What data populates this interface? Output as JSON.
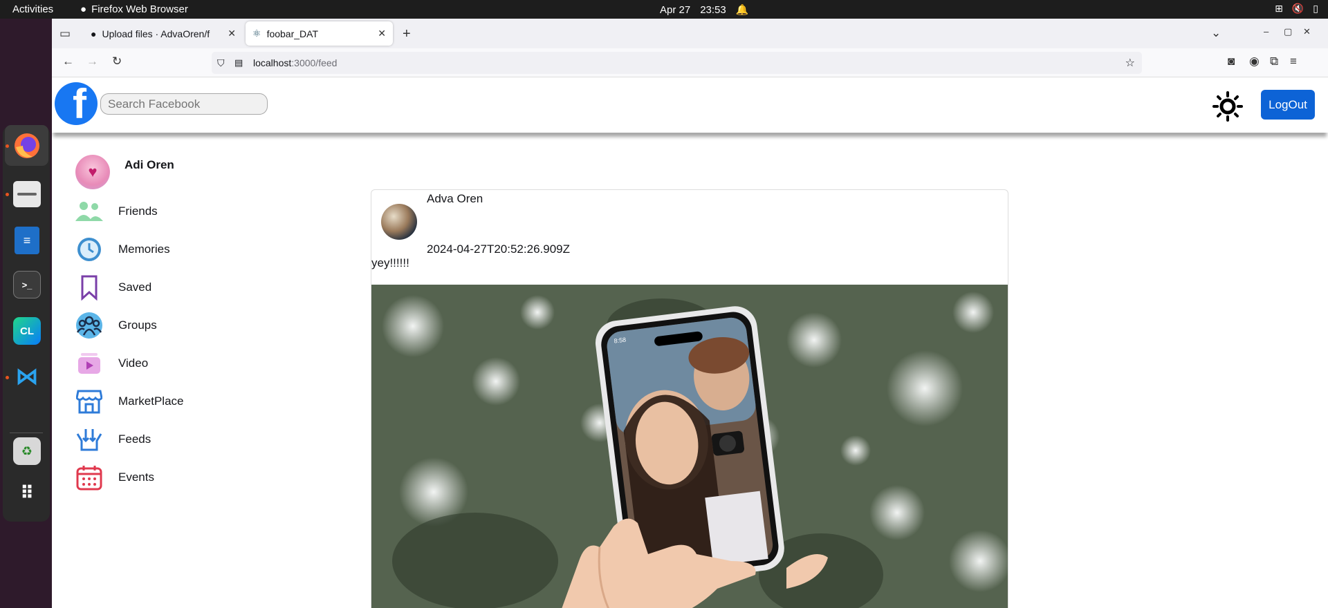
{
  "system": {
    "activities": "Activities",
    "app_name": "Firefox Web Browser",
    "date": "Apr 27",
    "time": "23:53"
  },
  "browser": {
    "tabs": [
      {
        "label": "Upload files · AdvaOren/f",
        "icon": "github-icon"
      },
      {
        "label": "foobar_DAT",
        "icon": "react-icon"
      }
    ],
    "url": {
      "host": "localhost",
      "path": ":3000/feed"
    }
  },
  "header": {
    "logo": "f",
    "search_placeholder": "Search Facebook",
    "logout_label": "LogOut"
  },
  "sidebar": {
    "user_name": "Adi Oren",
    "items": [
      {
        "label": "Friends",
        "icon": "friends-icon"
      },
      {
        "label": "Memories",
        "icon": "clock-icon"
      },
      {
        "label": "Saved",
        "icon": "bookmark-icon"
      },
      {
        "label": "Groups",
        "icon": "groups-icon"
      },
      {
        "label": "Video",
        "icon": "video-icon"
      },
      {
        "label": "MarketPlace",
        "icon": "store-icon"
      },
      {
        "label": "Feeds",
        "icon": "feeds-icon"
      },
      {
        "label": "Events",
        "icon": "calendar-icon"
      }
    ]
  },
  "post": {
    "author": "Adva Oren",
    "date": "2024-04-27T20:52:26.909Z",
    "text": "yey!!!!!!",
    "phone_time": "8:58"
  }
}
